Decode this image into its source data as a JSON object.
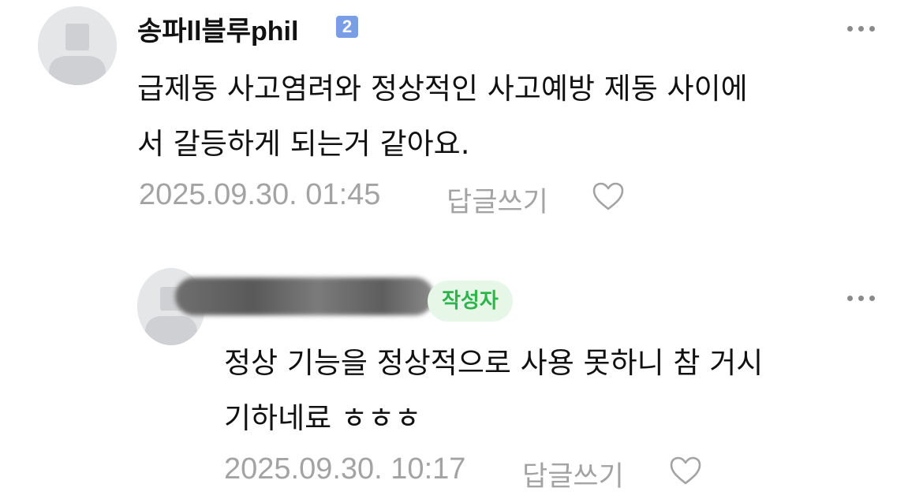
{
  "comments": [
    {
      "author": "송파ll블루phil",
      "level": "2",
      "text_line1": "급제동 사고염려와 정상적인 사고예방 제동 사이에",
      "text_line2": "서 갈등하게 되는거 같아요.",
      "date": "2025.09.30. 01:45",
      "reply_label": "답글쓰기"
    },
    {
      "author_badge": "작성자",
      "text_line1": "정상 기능을 정상적으로 사용 못하니 참 거시",
      "text_line2": "기하네료 ㅎㅎㅎ",
      "date": "2025.09.30. 10:17",
      "reply_label": "답글쓰기"
    }
  ],
  "colors": {
    "meta_text": "#a3a3a3",
    "level_badge": "#7a9ee6",
    "author_badge_bg": "#e6f7e8",
    "author_badge_text": "#2db44c"
  },
  "icons": {
    "avatar": "default-profile-icon",
    "more": "more-dots-icon",
    "like": "heart-outline-icon"
  }
}
